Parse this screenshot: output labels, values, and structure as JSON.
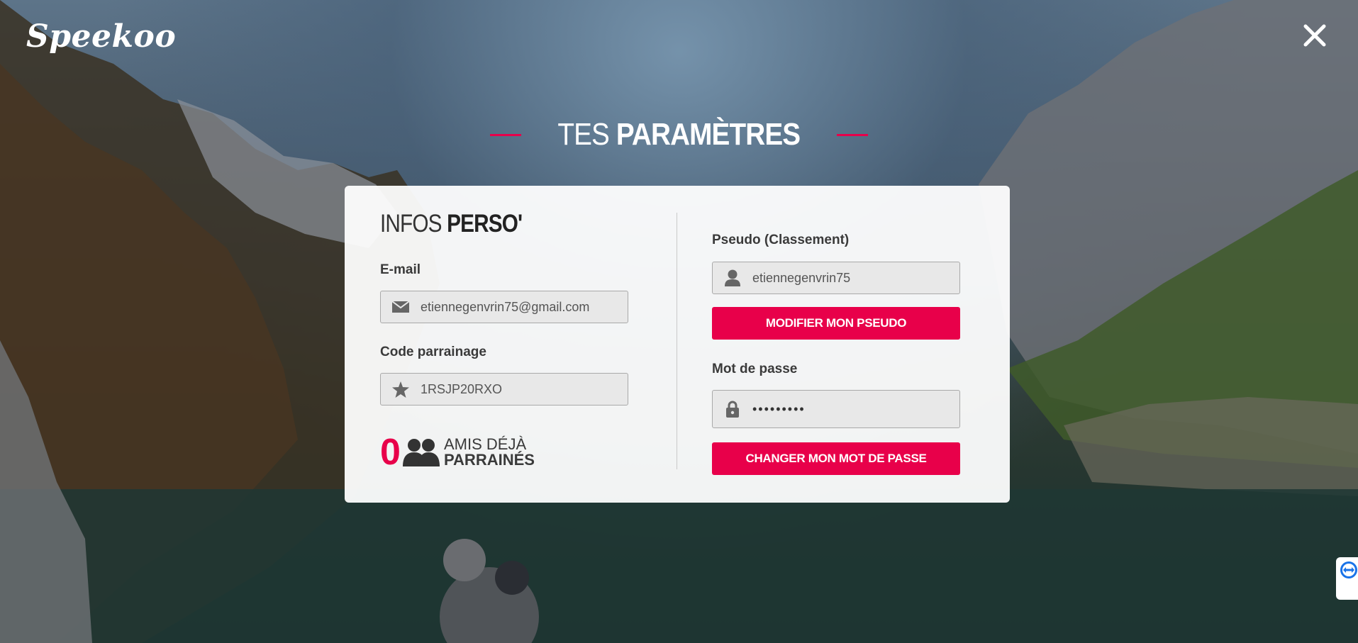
{
  "app": {
    "logo_text": "Speekoo",
    "close_icon": "close-icon"
  },
  "page": {
    "title_light": "TES ",
    "title_bold": "PARAMÈTRES",
    "accent_color": "#e8004a"
  },
  "infos": {
    "title_light": "INFOS ",
    "title_bold": "PERSO'",
    "email_label": "E-mail",
    "email_value": "etiennegenvrin75@gmail.com",
    "email_icon": "envelope-icon",
    "code_label": "Code parrainage",
    "code_value": "1RSJP20RXO",
    "code_icon": "star-icon",
    "friends_count": "0",
    "friends_icon": "users-icon",
    "friends_line1": "AMIS DÉJÀ",
    "friends_line2": "PARRAINÉS"
  },
  "account": {
    "pseudo_label": "Pseudo (Classement)",
    "pseudo_value": "etiennegenvrin75",
    "pseudo_icon": "user-icon",
    "pseudo_button": "MODIFIER MON PSEUDO",
    "password_label": "Mot de passe",
    "password_value": "•••••••••",
    "password_icon": "lock-icon",
    "password_button": "CHANGER MON MOT DE PASSE"
  }
}
